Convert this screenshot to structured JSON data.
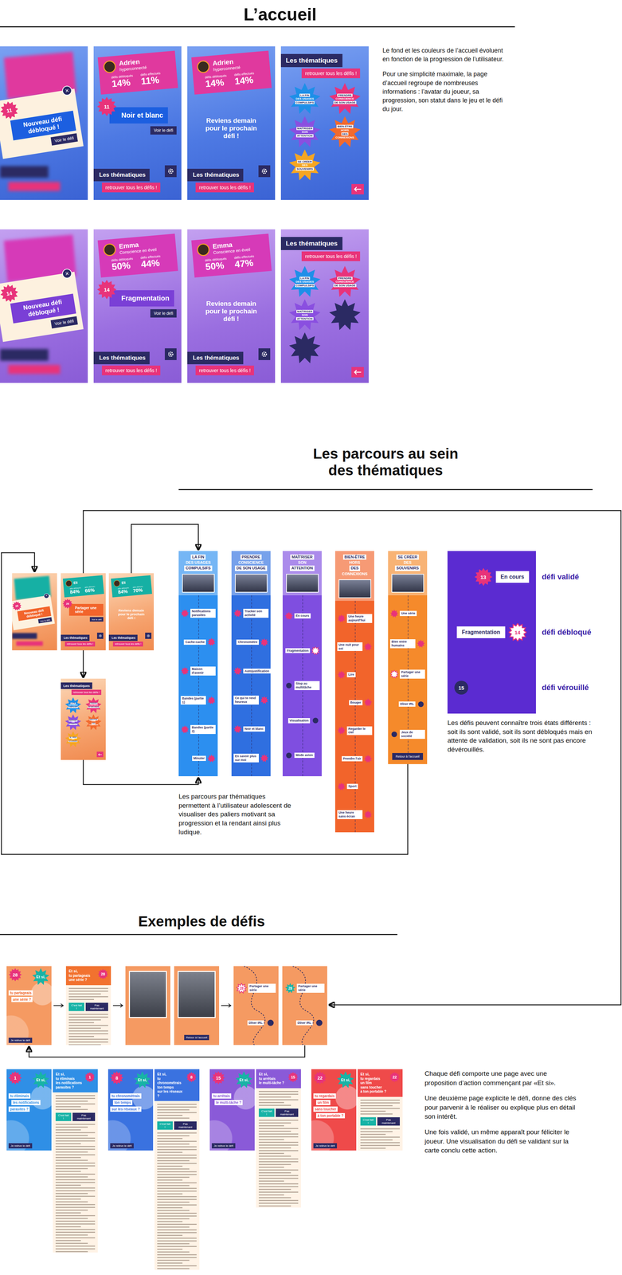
{
  "accueil": {
    "title": "L’accueil",
    "description": [
      "Le fond et les couleurs de l’accueil évoluent en fonction de la progression de l’utilisateur.",
      "Pour une simplicité maximale, la page d’accueil regroupe de nombreuses informations : l’avatar du joueur, sa progression, son statut dans le jeu et le défi du jour."
    ],
    "footer": {
      "title": "Les thématiques",
      "link": "retrouver tous les défis !"
    },
    "rows": [
      {
        "kind": "blue",
        "player": {
          "name": "Adrien",
          "status": "hyperconnecté"
        },
        "popup": {
          "number": "11",
          "message": "Nouveau défi débloqué !",
          "button": "Voir le défi",
          "close": "×"
        },
        "home": {
          "stats": [
            {
              "value": "14%",
              "label": "défis débloqués"
            },
            {
              "value": "11%",
              "label": "défis effectués"
            }
          ],
          "challenge": {
            "number": "11",
            "title": "Noir et blanc",
            "button": "Voir le défi"
          }
        },
        "wait": {
          "stats": [
            {
              "value": "14%",
              "label": "défis débloqués"
            },
            {
              "value": "14%",
              "label": "défis effectués"
            }
          ],
          "message": "Reviens demain pour le prochain défi !"
        },
        "badges": [
          {
            "lines": [
              "LA FIN",
              "DES USAGES",
              "COMPULSIFS"
            ],
            "color": "#1e8fe8",
            "locked": false
          },
          {
            "lines": [
              "PRENDRE",
              "CONSCIENCE",
              "DE SON USAGE"
            ],
            "color": "#e8337a",
            "locked": false
          },
          {
            "lines": [
              "MAÎTRISER",
              "SON",
              "ATTENTION"
            ],
            "color": "#8a4fe0",
            "locked": false
          },
          {
            "lines": [
              "BIEN-ÊTRE",
              "HORS",
              "DES",
              "CONNEXIONS"
            ],
            "color": "#f26a2e",
            "locked": false
          },
          {
            "lines": [
              "SE CRÉER",
              "DES",
              "SOUVENIRS"
            ],
            "color": "#f5a623",
            "locked": false
          }
        ]
      },
      {
        "kind": "purple",
        "player": {
          "name": "Emma",
          "status": "Conscience en éveil"
        },
        "popup": {
          "number": "14",
          "message": "Nouveau défi débloqué !",
          "button": "Voir le défi",
          "close": "×"
        },
        "home": {
          "stats": [
            {
              "value": "50%",
              "label": "défis débloqués"
            },
            {
              "value": "44%",
              "label": "défis effectués"
            }
          ],
          "challenge": {
            "number": "14",
            "title": "Fragmentation",
            "button": "Voir le défi"
          }
        },
        "wait": {
          "stats": [
            {
              "value": "50%",
              "label": "défis débloqués"
            },
            {
              "value": "47%",
              "label": "défis effectués"
            }
          ],
          "message": "Reviens demain pour le prochain défi !"
        },
        "badges": [
          {
            "lines": [
              "LA FIN",
              "DES USAGES",
              "COMPULSIFS"
            ],
            "color": "#1e8fe8",
            "locked": false
          },
          {
            "lines": [
              "PRENDRE",
              "CONSCIENCE",
              "DE SON USAGE"
            ],
            "color": "#e8337a",
            "locked": false
          },
          {
            "lines": [
              "MAÎTRISER",
              "SON",
              "ATTENTION"
            ],
            "color": "#8a4fe0",
            "locked": false
          },
          {
            "lines": [],
            "color": "#2b2a63",
            "locked": true
          },
          {
            "lines": [],
            "color": "#2b2a63",
            "locked": true
          }
        ]
      }
    ]
  },
  "parcours": {
    "title": [
      "Les parcours au sein",
      "des thématiques"
    ],
    "player": {
      "name": "Eli"
    },
    "popup": {
      "number": "28",
      "message": "Nouveau défi débloqué !",
      "button": "Voir le défi",
      "close": "×"
    },
    "home": {
      "stats": [
        {
          "value": "84%",
          "label": "défis débloqués"
        },
        {
          "value": "66%",
          "label": "défis effectués"
        }
      ],
      "challenge": {
        "number": "28",
        "title": "Partager une série",
        "button": "Voir le défi"
      }
    },
    "wait": {
      "stats": [
        {
          "value": "84%",
          "label": "défis débloqués"
        },
        {
          "value": "70%",
          "label": "défis effectués"
        }
      ],
      "message": "Reviens demain pour le prochain défi !"
    },
    "tracks": [
      {
        "title": [
          "LA FIN",
          "DES USAGES",
          "COMPULSIFS"
        ],
        "color": "#2c8ff0",
        "steps": [
          {
            "label": "Notifications parasites",
            "state": "done"
          },
          {
            "label": "Cache-cache",
            "state": "done"
          },
          {
            "label": "Maison d'avenir",
            "state": "done"
          },
          {
            "label": "Bandes (partie 1)",
            "state": "done"
          },
          {
            "label": "Bandes (partie 2)",
            "state": "done"
          },
          {
            "label": "Minuter",
            "state": "done"
          }
        ]
      },
      {
        "title": [
          "PRENDRE",
          "CONSCIENCE",
          "DE SON USAGE"
        ],
        "color": "#2f6fe0",
        "steps": [
          {
            "label": "Tracker son activité",
            "state": "done"
          },
          {
            "label": "Chronomètre",
            "state": "done"
          },
          {
            "label": "Autojustification",
            "state": "done"
          },
          {
            "label": "Ce qui te rend heureux",
            "state": "done"
          },
          {
            "label": "Noir et blanc",
            "state": "done"
          },
          {
            "label": "En savoir plus sur moi",
            "state": "done"
          }
        ]
      },
      {
        "title": [
          "MAÎTRISER",
          "SON",
          "ATTENTION"
        ],
        "color": "#7f4ee0",
        "steps": [
          {
            "label": "En cours",
            "state": "done"
          },
          {
            "label": "Fragmentation",
            "state": "unlocked"
          },
          {
            "label": "Stop au multitâche",
            "state": "locked"
          },
          {
            "label": "Visualisation",
            "state": "locked"
          },
          {
            "label": "Mode avion",
            "state": "locked"
          }
        ]
      },
      {
        "title": [
          "BIEN-ÊTRE",
          "HORS",
          "DES",
          "CONNEXIONS"
        ],
        "color": "#f2642b",
        "steps": [
          {
            "label": "Une heure aujourd'hui",
            "state": "done"
          },
          {
            "label": "Une nuit pour soi",
            "state": "done"
          },
          {
            "label": "Lire",
            "state": "done"
          },
          {
            "label": "Bouger",
            "state": "done"
          },
          {
            "label": "Regarder le ciel",
            "state": "done"
          },
          {
            "label": "Prendre l'air",
            "state": "done"
          },
          {
            "label": "Sport",
            "state": "done"
          },
          {
            "label": "Une heure sans écran",
            "state": "done"
          }
        ]
      },
      {
        "title": [
          "SE CRÉER",
          "DES",
          "SOUVENIRS"
        ],
        "color": "#f58a2b",
        "steps": [
          {
            "label": "Une série",
            "state": "done"
          },
          {
            "label": "Bien entre humains",
            "state": "done"
          },
          {
            "label": "Partager une série",
            "state": "unlocked"
          },
          {
            "label": "Dîner IRL",
            "state": "locked"
          },
          {
            "label": "Jeux de société",
            "state": "locked"
          }
        ],
        "footer": "Retour à l'accueil"
      }
    ],
    "legend": {
      "items": [
        {
          "number": "13",
          "label": "En cours",
          "state": "done",
          "caption": "défi validé"
        },
        {
          "number": "14",
          "label": "Fragmentation",
          "state": "unlocked",
          "caption": "défi débloqué"
        },
        {
          "number": "15",
          "state": "locked",
          "caption": "défi vérouillé"
        }
      ],
      "text": "Les défis peuvent connaître trois états différents : soit ils sont validé, soit ils sont débloqués mais en attente de validation, soit ils ne sont pas encore dévérouillés."
    },
    "caption": "Les parcours par thématiques permettent à l’utilisateur adolescent de visualiser des paliers motivant sa progression et la rendant ainsi plus ludique."
  },
  "defis": {
    "title": "Exemples de défis",
    "cta": "Je relève le défi",
    "done": "C'est fait !",
    "later": "Pas maintenant",
    "flow": [
      {
        "kind": "cover",
        "number": "28",
        "prefix": "Et si,",
        "question": [
          "tu partageais",
          "une série ?"
        ],
        "arrow_after": true
      },
      {
        "kind": "detail",
        "number": "28",
        "prefix": "Et si,",
        "question": [
          "tu partageais",
          "une série ?"
        ],
        "arrow_after": true
      },
      {
        "kind": "meme",
        "arrow_after": false
      },
      {
        "kind": "meme",
        "button": "Retour à l'accueil",
        "arrow_after": true
      },
      {
        "kind": "map",
        "steps": [
          {
            "label": "Partager une série",
            "number": "28",
            "state": "unlocked"
          },
          {
            "label": "Dîner IRL",
            "state": "locked"
          }
        ],
        "arrow_after": false
      },
      {
        "kind": "map",
        "steps": [
          {
            "label": "Partager une série",
            "number": "28",
            "state": "done"
          },
          {
            "label": "Dîner IRL",
            "state": "locked"
          }
        ],
        "arrow_after": false
      }
    ],
    "examples": [
      {
        "number": "1",
        "prefix": "Et si,",
        "question": [
          "tu éliminais",
          "les notifications",
          "parasites ?"
        ],
        "color": "#2f8fe6"
      },
      {
        "number": "8",
        "prefix": "Et si,",
        "question": [
          "tu chronométrais",
          "ton temps",
          "sur les réseaux ?"
        ],
        "color": "#3a72e0"
      },
      {
        "number": "15",
        "prefix": "Et si,",
        "question": [
          "tu arrêtais",
          "le multi-tâche ?"
        ],
        "color": "#8a5ad8"
      },
      {
        "number": "22",
        "prefix": "Et si,",
        "question": [
          "tu regardais",
          "un film",
          "sans toucher",
          "à ton portable ?"
        ],
        "color": "#ef4a4a"
      }
    ],
    "description": [
      "Chaque défi comporte une page avec une proposition d’action commençant par «Et si».",
      "Une deuxième page explicite le défi, donne des clés pour parvenir à le réaliser ou explique plus en détail son intérêt.",
      "Une fois validé, un même apparaît pour féliciter le joueur. Une visualisation du défi se validant sur la carte conclu cette action."
    ]
  }
}
